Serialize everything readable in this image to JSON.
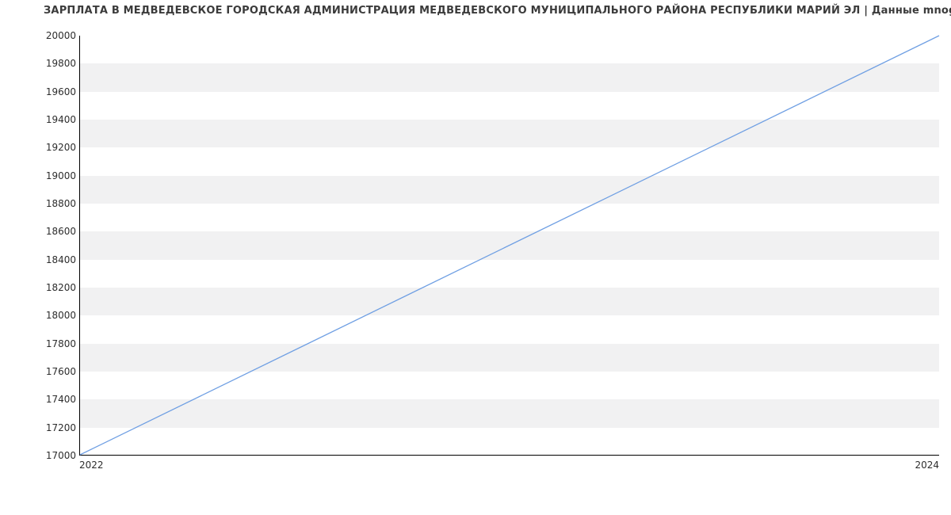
{
  "chart_data": {
    "type": "line",
    "title": "ЗАРПЛАТА В МЕДВЕДЕВСКОЕ ГОРОДСКАЯ АДМИНИСТРАЦИЯ МЕДВЕДЕВСКОГО МУНИЦИПАЛЬНОГО РАЙОНА РЕСПУБЛИКИ МАРИЙ ЭЛ | Данные mnogo.work",
    "xlabel": "",
    "ylabel": "",
    "x": [
      2022,
      2024
    ],
    "values": [
      17000,
      20000
    ],
    "x_ticks": [
      "2022",
      "2024"
    ],
    "y_ticks": [
      17000,
      17200,
      17400,
      17600,
      17800,
      18000,
      18200,
      18400,
      18600,
      18800,
      19000,
      19200,
      19400,
      19600,
      19800,
      20000
    ],
    "ylim": [
      17000,
      20000
    ],
    "xlim": [
      2022,
      2024
    ],
    "line_color": "#6f9fe3",
    "band_color": "#f1f1f2",
    "grid": "banded"
  }
}
